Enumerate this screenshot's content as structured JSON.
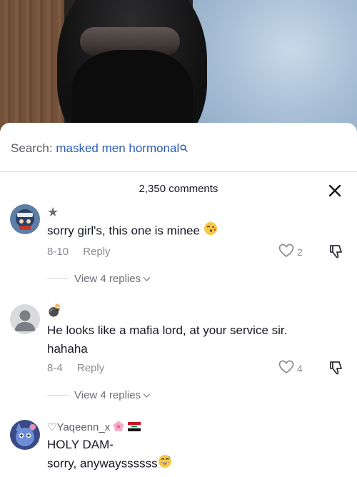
{
  "search": {
    "label": "Search:",
    "query": "masked men hormonal"
  },
  "comments_header": {
    "count_text": "2,350 comments"
  },
  "comments": [
    {
      "username": "★",
      "text": "sorry girl's, this one is minee",
      "emoji": "kissing-face-emoji",
      "date": "8-10",
      "reply_label": "Reply",
      "likes": "2",
      "view_replies": "View 4 replies"
    },
    {
      "username": "💣",
      "text_line1": "He looks like a mafia lord, at your service sir.",
      "text_line2": "hahaha",
      "date": "8-4",
      "reply_label": "Reply",
      "likes": "4",
      "view_replies": "View 4 replies"
    },
    {
      "username": "♡Yaqeenn_x",
      "username_emojis": [
        "cherry-blossom-emoji",
        "iraq-flag-emoji"
      ],
      "text_line1": "HOLY DAM-",
      "text_line2": "sorry, anywayssssss",
      "emoji": "grinning-sweat-emoji"
    }
  ],
  "colors": {
    "link_blue": "#2b5db8",
    "text_dark": "#161823",
    "text_muted": "#8a8b91"
  }
}
